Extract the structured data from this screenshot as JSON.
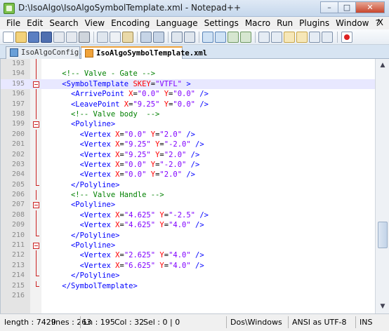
{
  "window": {
    "title": "D:\\IsoAlgo\\IsoAlgoSymbolTemplate.xml - Notepad++",
    "minimize_label": "–",
    "maximize_label": "□",
    "close_label": "✕"
  },
  "menu": {
    "items": [
      "File",
      "Edit",
      "Search",
      "View",
      "Encoding",
      "Language",
      "Settings",
      "Macro",
      "Run",
      "Plugins",
      "Window",
      "?"
    ],
    "close_label": "X"
  },
  "tabs": [
    {
      "label": "IsoAlgoConfig.xml",
      "active": false
    },
    {
      "label": "IsoAlgoSymbolTemplate.xml",
      "active": true
    }
  ],
  "editor": {
    "current_line": 195,
    "lines": [
      {
        "num": "193",
        "fold": "line",
        "segments": []
      },
      {
        "num": "194",
        "fold": "line",
        "segments": [
          {
            "t": "    ",
            "c": ""
          },
          {
            "t": "<!-- Valve - Gate -->",
            "c": "comment"
          }
        ]
      },
      {
        "num": "195",
        "fold": "box",
        "segments": [
          {
            "t": "    ",
            "c": ""
          },
          {
            "t": "<SymbolTemplate",
            "c": "tag"
          },
          {
            "t": " SKEY",
            "c": "attr"
          },
          {
            "t": "=",
            "c": "eq"
          },
          {
            "t": "\"VTFL\"",
            "c": "val"
          },
          {
            "t": " >",
            "c": "tag"
          }
        ]
      },
      {
        "num": "196",
        "fold": "line",
        "segments": [
          {
            "t": "      ",
            "c": ""
          },
          {
            "t": "<ArrivePoint",
            "c": "tag"
          },
          {
            "t": " X",
            "c": "attr"
          },
          {
            "t": "=",
            "c": "eq"
          },
          {
            "t": "\"0.0\"",
            "c": "val"
          },
          {
            "t": " Y",
            "c": "attr"
          },
          {
            "t": "=",
            "c": "eq"
          },
          {
            "t": "\"0.0\"",
            "c": "val"
          },
          {
            "t": " />",
            "c": "tag"
          }
        ]
      },
      {
        "num": "197",
        "fold": "line",
        "segments": [
          {
            "t": "      ",
            "c": ""
          },
          {
            "t": "<LeavePoint",
            "c": "tag"
          },
          {
            "t": " X",
            "c": "attr"
          },
          {
            "t": "=",
            "c": "eq"
          },
          {
            "t": "\"9.25\"",
            "c": "val"
          },
          {
            "t": " Y",
            "c": "attr"
          },
          {
            "t": "=",
            "c": "eq"
          },
          {
            "t": "\"0.0\"",
            "c": "val"
          },
          {
            "t": " />",
            "c": "tag"
          }
        ]
      },
      {
        "num": "198",
        "fold": "line",
        "segments": [
          {
            "t": "      ",
            "c": ""
          },
          {
            "t": "<!-- Valve body  -->",
            "c": "comment"
          }
        ]
      },
      {
        "num": "199",
        "fold": "box",
        "segments": [
          {
            "t": "      ",
            "c": ""
          },
          {
            "t": "<Polyline>",
            "c": "tag"
          }
        ]
      },
      {
        "num": "200",
        "fold": "line",
        "segments": [
          {
            "t": "        ",
            "c": ""
          },
          {
            "t": "<Vertex",
            "c": "tag"
          },
          {
            "t": " X",
            "c": "attr"
          },
          {
            "t": "=",
            "c": "eq"
          },
          {
            "t": "\"0.0\"",
            "c": "val"
          },
          {
            "t": " Y",
            "c": "attr"
          },
          {
            "t": "=",
            "c": "eq"
          },
          {
            "t": "\"2.0\"",
            "c": "val"
          },
          {
            "t": " />",
            "c": "tag"
          }
        ]
      },
      {
        "num": "201",
        "fold": "line",
        "segments": [
          {
            "t": "        ",
            "c": ""
          },
          {
            "t": "<Vertex",
            "c": "tag"
          },
          {
            "t": " X",
            "c": "attr"
          },
          {
            "t": "=",
            "c": "eq"
          },
          {
            "t": "\"9.25\"",
            "c": "val"
          },
          {
            "t": " Y",
            "c": "attr"
          },
          {
            "t": "=",
            "c": "eq"
          },
          {
            "t": "\"-2.0\"",
            "c": "val"
          },
          {
            "t": " />",
            "c": "tag"
          }
        ]
      },
      {
        "num": "202",
        "fold": "line",
        "segments": [
          {
            "t": "        ",
            "c": ""
          },
          {
            "t": "<Vertex",
            "c": "tag"
          },
          {
            "t": " X",
            "c": "attr"
          },
          {
            "t": "=",
            "c": "eq"
          },
          {
            "t": "\"9.25\"",
            "c": "val"
          },
          {
            "t": " Y",
            "c": "attr"
          },
          {
            "t": "=",
            "c": "eq"
          },
          {
            "t": "\"2.0\"",
            "c": "val"
          },
          {
            "t": " />",
            "c": "tag"
          }
        ]
      },
      {
        "num": "203",
        "fold": "line",
        "segments": [
          {
            "t": "        ",
            "c": ""
          },
          {
            "t": "<Vertex",
            "c": "tag"
          },
          {
            "t": " X",
            "c": "attr"
          },
          {
            "t": "=",
            "c": "eq"
          },
          {
            "t": "\"0.0\"",
            "c": "val"
          },
          {
            "t": " Y",
            "c": "attr"
          },
          {
            "t": "=",
            "c": "eq"
          },
          {
            "t": "\"-2.0\"",
            "c": "val"
          },
          {
            "t": " />",
            "c": "tag"
          }
        ]
      },
      {
        "num": "204",
        "fold": "line",
        "segments": [
          {
            "t": "        ",
            "c": ""
          },
          {
            "t": "<Vertex",
            "c": "tag"
          },
          {
            "t": " X",
            "c": "attr"
          },
          {
            "t": "=",
            "c": "eq"
          },
          {
            "t": "\"0.0\"",
            "c": "val"
          },
          {
            "t": " Y",
            "c": "attr"
          },
          {
            "t": "=",
            "c": "eq"
          },
          {
            "t": "\"2.0\"",
            "c": "val"
          },
          {
            "t": " />",
            "c": "tag"
          }
        ]
      },
      {
        "num": "205",
        "fold": "end",
        "segments": [
          {
            "t": "      ",
            "c": ""
          },
          {
            "t": "</Polyline>",
            "c": "tag"
          }
        ]
      },
      {
        "num": "206",
        "fold": "line",
        "segments": [
          {
            "t": "      ",
            "c": ""
          },
          {
            "t": "<!-- Valve Handle -->",
            "c": "comment"
          }
        ]
      },
      {
        "num": "207",
        "fold": "box",
        "segments": [
          {
            "t": "      ",
            "c": ""
          },
          {
            "t": "<Polyline>",
            "c": "tag"
          }
        ]
      },
      {
        "num": "208",
        "fold": "line",
        "segments": [
          {
            "t": "        ",
            "c": ""
          },
          {
            "t": "<Vertex",
            "c": "tag"
          },
          {
            "t": " X",
            "c": "attr"
          },
          {
            "t": "=",
            "c": "eq"
          },
          {
            "t": "\"4.625\"",
            "c": "val"
          },
          {
            "t": " Y",
            "c": "attr"
          },
          {
            "t": "=",
            "c": "eq"
          },
          {
            "t": "\"-2.5\"",
            "c": "val"
          },
          {
            "t": " />",
            "c": "tag"
          }
        ]
      },
      {
        "num": "209",
        "fold": "line",
        "segments": [
          {
            "t": "        ",
            "c": ""
          },
          {
            "t": "<Vertex",
            "c": "tag"
          },
          {
            "t": " X",
            "c": "attr"
          },
          {
            "t": "=",
            "c": "eq"
          },
          {
            "t": "\"4.625\"",
            "c": "val"
          },
          {
            "t": " Y",
            "c": "attr"
          },
          {
            "t": "=",
            "c": "eq"
          },
          {
            "t": "\"4.0\"",
            "c": "val"
          },
          {
            "t": " />",
            "c": "tag"
          }
        ]
      },
      {
        "num": "210",
        "fold": "end",
        "segments": [
          {
            "t": "      ",
            "c": ""
          },
          {
            "t": "</Polyline>",
            "c": "tag"
          }
        ]
      },
      {
        "num": "211",
        "fold": "box",
        "segments": [
          {
            "t": "      ",
            "c": ""
          },
          {
            "t": "<Polyline>",
            "c": "tag"
          }
        ]
      },
      {
        "num": "212",
        "fold": "line",
        "segments": [
          {
            "t": "        ",
            "c": ""
          },
          {
            "t": "<Vertex",
            "c": "tag"
          },
          {
            "t": " X",
            "c": "attr"
          },
          {
            "t": "=",
            "c": "eq"
          },
          {
            "t": "\"2.625\"",
            "c": "val"
          },
          {
            "t": " Y",
            "c": "attr"
          },
          {
            "t": "=",
            "c": "eq"
          },
          {
            "t": "\"4.0\"",
            "c": "val"
          },
          {
            "t": " />",
            "c": "tag"
          }
        ]
      },
      {
        "num": "213",
        "fold": "line",
        "segments": [
          {
            "t": "        ",
            "c": ""
          },
          {
            "t": "<Vertex",
            "c": "tag"
          },
          {
            "t": " X",
            "c": "attr"
          },
          {
            "t": "=",
            "c": "eq"
          },
          {
            "t": "\"6.625\"",
            "c": "val"
          },
          {
            "t": " Y",
            "c": "attr"
          },
          {
            "t": "=",
            "c": "eq"
          },
          {
            "t": "\"4.0\"",
            "c": "val"
          },
          {
            "t": " />",
            "c": "tag"
          }
        ]
      },
      {
        "num": "214",
        "fold": "end",
        "segments": [
          {
            "t": "      ",
            "c": ""
          },
          {
            "t": "</Polyline>",
            "c": "tag"
          }
        ]
      },
      {
        "num": "215",
        "fold": "end",
        "segments": [
          {
            "t": "    ",
            "c": ""
          },
          {
            "t": "</SymbolTemplate>",
            "c": "tag"
          }
        ]
      },
      {
        "num": "216",
        "fold": "none",
        "segments": []
      }
    ]
  },
  "status": {
    "length": "length : 7429",
    "lines": "lines : 263",
    "ln": "Ln : 195",
    "col": "Col : 32",
    "sel": "Sel : 0 | 0",
    "eol": "Dos\\Windows",
    "encoding": "ANSI as UTF-8",
    "mode": "INS"
  },
  "colors": {
    "comment": "#008000",
    "tag": "#0000ff",
    "attribute": "#ff0000",
    "value": "#8000ff",
    "current_line": "#e8e8ff"
  },
  "toolbar_icons": [
    "new-file-icon",
    "open-file-icon",
    "save-icon",
    "save-all-icon",
    "close-icon",
    "close-all-icon",
    "print-icon",
    "cut-icon",
    "copy-icon",
    "paste-icon",
    "undo-icon",
    "redo-icon",
    "find-icon",
    "replace-icon",
    "zoom-in-icon",
    "zoom-out-icon",
    "sync-v-icon",
    "sync-h-icon",
    "wrap-icon",
    "all-chars-icon",
    "indent-guide-icon",
    "udl-icon",
    "doc-map-icon",
    "function-list-icon",
    "record-macro-icon"
  ]
}
